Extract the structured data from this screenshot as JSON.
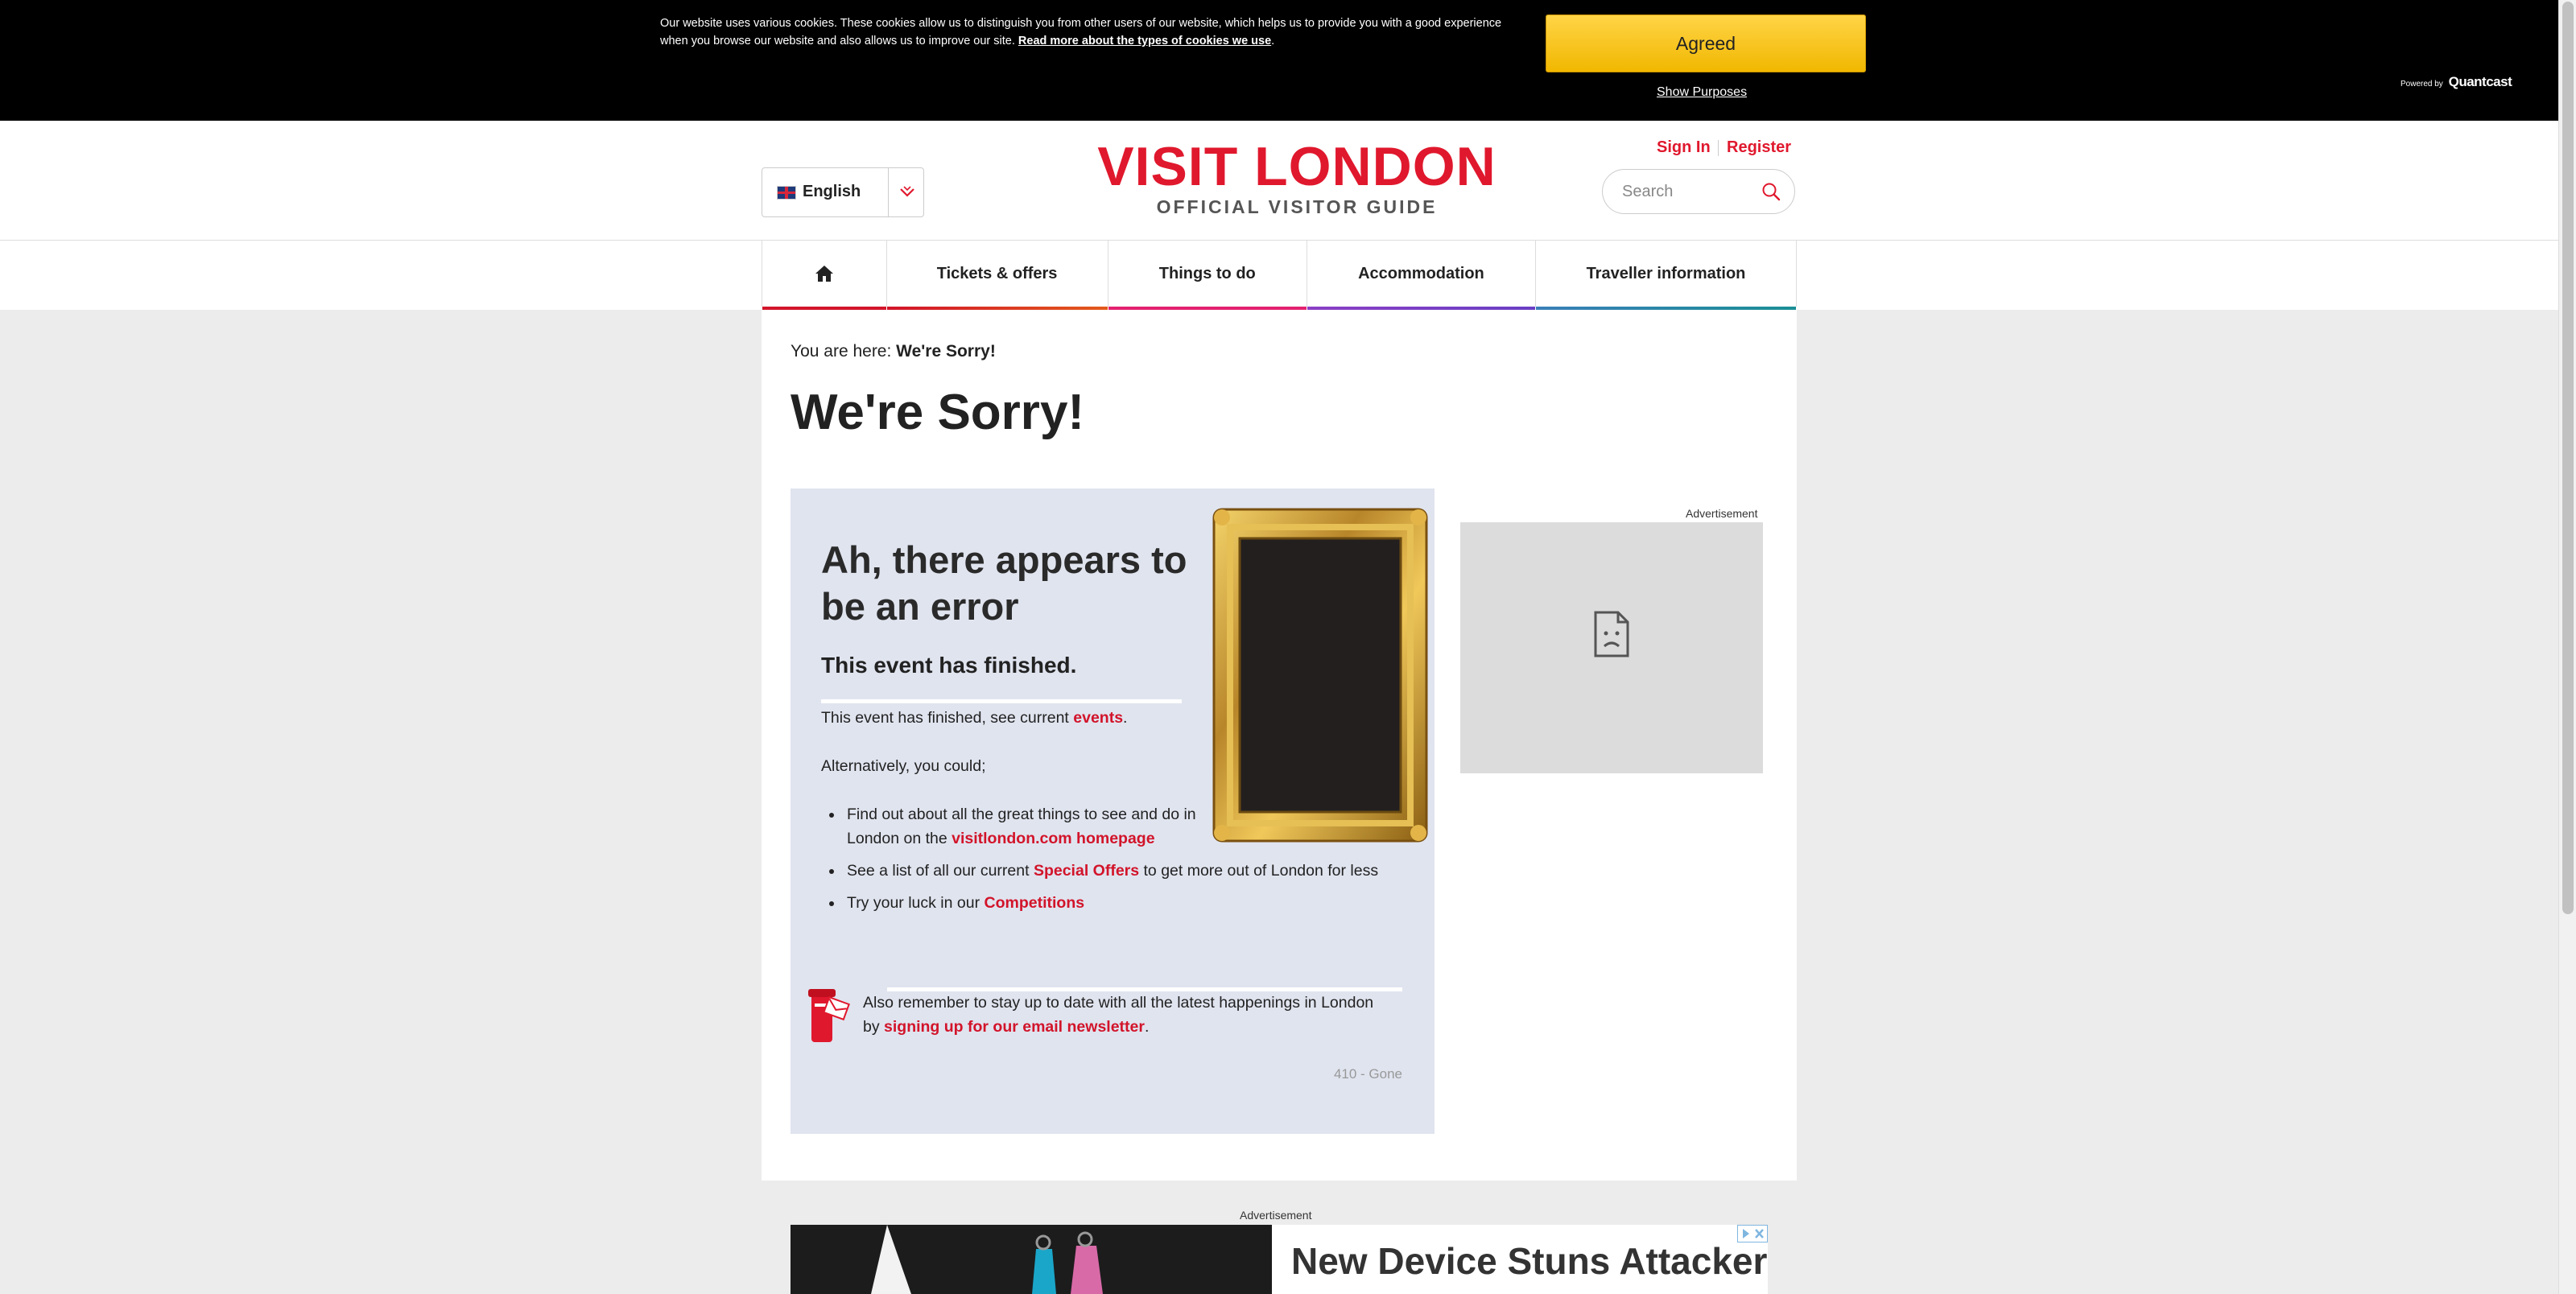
{
  "cookie_bar": {
    "text": "Our website uses various cookies. These cookies allow us to distinguish you from other users of our website, which helps us to provide you with a good experience when you browse our website and also allows us to improve our site.",
    "link_label": "Read more about the types of cookies we use",
    "agreed_label": "Agreed",
    "show_purposes_label": "Show Purposes",
    "powered_by_label": "Powered by",
    "powered_by_brand": "Quantcast"
  },
  "header": {
    "language": "English",
    "logo_title": "VISIT LONDON",
    "logo_subtitle": "OFFICIAL VISITOR GUIDE",
    "sign_in": "Sign In",
    "register": "Register",
    "search_placeholder": "Search"
  },
  "nav": {
    "items": [
      {
        "label": "Tickets & offers"
      },
      {
        "label": "Things to do"
      },
      {
        "label": "Accommodation"
      },
      {
        "label": "Traveller information"
      }
    ],
    "colors": [
      "#d2142a",
      "#e35a1b",
      "#e3226f",
      "#7b3fc4",
      "#7b3fc4",
      "#1b8f96"
    ]
  },
  "breadcrumb": {
    "prefix": "You are here:",
    "current": "We're Sorry!"
  },
  "page_title": "We're Sorry!",
  "error": {
    "heading": "Ah, there appears to be an error",
    "subheading": "This event has finished.",
    "para1_text": "This event has finished, see current ",
    "para1_link": "events",
    "para1_end": ".",
    "para2": "Alternatively, you could;",
    "bullet1_text": "Find out about all the great things to see and do in London on the ",
    "bullet1_link": "visitlondon.com homepage",
    "bullet2_text": "See a list of all our current ",
    "bullet2_link": "Special Offers",
    "bullet2_end": " to get more out of London for less",
    "bullet3_text": "Try your luck in our ",
    "bullet3_link": "Competitions",
    "newsletter_text": "Also remember to stay up to date with all the latest happenings in London by ",
    "newsletter_link": "signing up for our email newsletter",
    "newsletter_end": ".",
    "status_code": "410 - Gone"
  },
  "ads": {
    "side_label": "Advertisement",
    "bottom_label": "Advertisement",
    "bottom_headline": "New Device Stuns Attacker"
  }
}
